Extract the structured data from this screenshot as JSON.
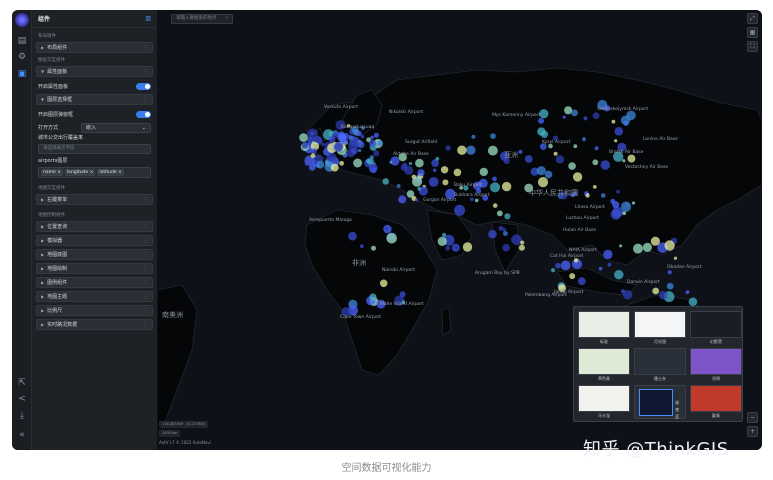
{
  "panel": {
    "title": "组件",
    "sections": {
      "layout": "布局组件",
      "layer_interaction": "图层交互组件",
      "map_interaction": "地图交互组件",
      "map_control": "地图控制组件"
    },
    "layout_bar": "布局组件",
    "attr_panel_bar": "属性面板",
    "toggle_attr_panel": "开启属性面板",
    "popup_bar": "图层选择框",
    "toggle_layer_popup": "开启图层弹窗框",
    "open_mode_label": "打开方式",
    "open_mode_value": "嵌入",
    "city_list_label": "城市公交出行覆盖率",
    "city_input_placeholder": "请选择展示字段",
    "airports_label": "airports图层",
    "fields": [
      "name",
      "longitude",
      "latitude"
    ],
    "map_interaction_bar": "右键菜单",
    "control_bars": [
      "位置查询",
      "模拟器",
      "地图底图",
      "地图绘制",
      "图例组件",
      "地图主题",
      "比例尺",
      "实时路况数据"
    ]
  },
  "map": {
    "search_placeholder": "请输入要搜索的地点",
    "coords": "116.387459 , 41.370630",
    "scale": "1000 km",
    "brand": "AntV L7 © 2022 AutoNavi",
    "labels": [
      "Vorkuta Airport",
      "Nikolski Airport",
      "Mys Kamenny Airport",
      "Srednekolymsk Airport",
      "Kangerlussuaq",
      "Surgut Airfield",
      "Aktobe Air Base",
      "Kyzyl Airport",
      "Bratsk Air Base",
      "Lonino Air Base",
      "Vostochny Air Base",
      "亚洲",
      "中华人民共和国",
      "Baku Airport",
      "Bukhara Airport",
      "Gorgan Airport",
      "Lhasa Airport",
      "Luzhou Airport",
      "Hulan Air Base",
      "Aeropuerto Malaga",
      "非洲",
      "Cat Hai Airport",
      "NAIA Airport",
      "Nairobi Airport",
      "Arugam Bay by SPB",
      "Obadan Airport",
      "Palembang Airport",
      "Jambi Airport",
      "Mahe Island Airport",
      "Darwin Airport",
      "Cape Town Airport",
      "南美洲"
    ]
  },
  "basemaps": [
    "标准",
    "月光银",
    "幻影黑",
    "草色青",
    "雅士灰",
    "涂鸦",
    "马卡龙",
    "极夜蓝",
    "靛青"
  ],
  "watermark": "知乎 @ThinkGIS",
  "caption": "空间数据可视化能力"
}
